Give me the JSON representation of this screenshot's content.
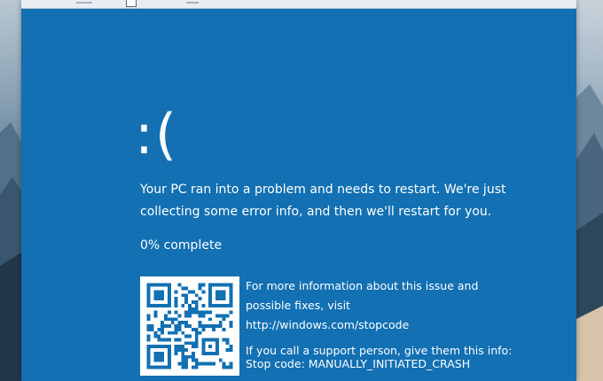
{
  "screen": {
    "background_color": "#1270b3",
    "text_color": "#ffffff"
  },
  "bsod": {
    "sad_face": ":(",
    "message_line1": "Your PC ran into a problem and needs to restart. We're just",
    "message_line2": "collecting some error info, and then we'll restart for you.",
    "progress_text": "0% complete",
    "qr_icon": "qr-code-icon",
    "info_line1": "For more information about this issue and",
    "info_line2": "possible fixes, visit",
    "info_link": "http://windows.com/stopcode",
    "support_line": "If you call a support person, give them this info:",
    "stop_code": "Stop code: MANUALLY_INITIATED_CRASH"
  }
}
